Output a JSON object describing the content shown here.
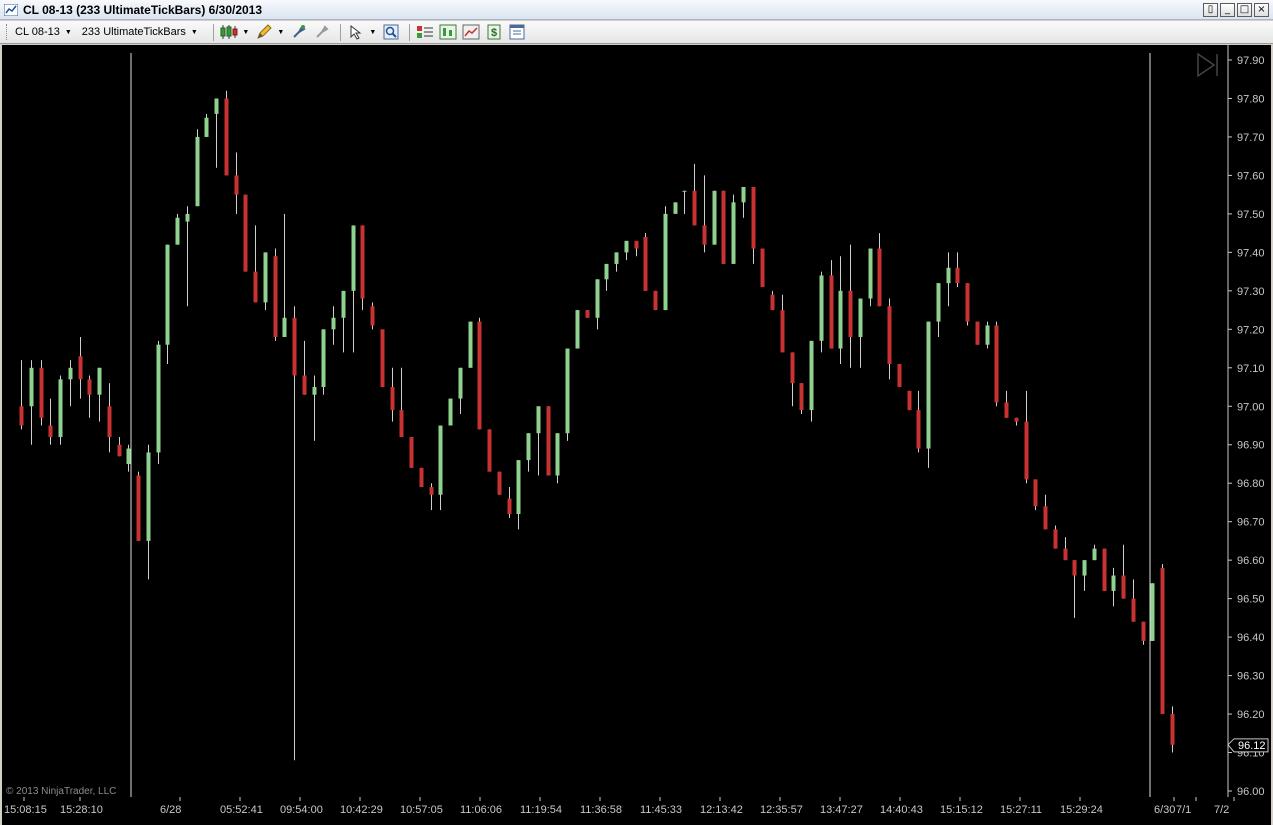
{
  "window": {
    "title": "CL 08-13 (233 UltimateTickBars)  6/30/2013",
    "buttons": [
      "restore-small",
      "minimize",
      "maximize",
      "close"
    ]
  },
  "toolbar": {
    "instrument": "CL 08-13",
    "period": "233 UltimateTickBars",
    "icons": [
      "candlestick-style-icon",
      "pencil-draw-icon",
      "hand-tool-icon",
      "strategy-tool-icon",
      "pointer-icon",
      "zoom-icon",
      "chart-trader-icon",
      "indicators-icon",
      "strategies-icon",
      "dollar-icon",
      "properties-icon"
    ]
  },
  "chart": {
    "copyright": "© 2013 NinjaTrader, LLC",
    "current_price_label": "96.12",
    "colors": {
      "up": "#8fd28f",
      "down": "#c83232",
      "background": "#000000",
      "axis_text": "#c8c8c8",
      "separator": "#e0e0e0"
    },
    "y_ticks": [
      "97.90",
      "97.80",
      "97.70",
      "97.60",
      "97.50",
      "97.40",
      "97.30",
      "97.20",
      "97.10",
      "97.00",
      "96.90",
      "96.80",
      "96.70",
      "96.60",
      "96.50",
      "96.40",
      "96.30",
      "96.20",
      "96.10",
      "96.00"
    ],
    "x_labels": [
      "15:08:15",
      "15:28:10",
      "6/28",
      "05:52:41",
      "09:54:00",
      "10:42:29",
      "10:57:05",
      "11:06:06",
      "11:19:54",
      "11:36:58",
      "11:45:33",
      "12:13:42",
      "12:35:57",
      "13:47:27",
      "14:40:43",
      "15:15:12",
      "15:27:11",
      "15:29:24",
      "6/30",
      "7/1",
      "7/2"
    ]
  },
  "chart_data": {
    "type": "candlestick",
    "title": "CL 08-13 (233 UltimateTickBars)  6/30/2013",
    "ylim": [
      96.0,
      97.9
    ],
    "last_price": 96.12,
    "ohlc": [
      [
        97.0,
        97.12,
        96.94,
        96.95
      ],
      [
        97.0,
        97.12,
        96.9,
        97.1
      ],
      [
        97.1,
        97.12,
        96.95,
        96.97
      ],
      [
        96.95,
        97.02,
        96.9,
        96.92
      ],
      [
        96.92,
        97.08,
        96.9,
        97.07
      ],
      [
        97.07,
        97.12,
        97.0,
        97.1
      ],
      [
        97.13,
        97.18,
        97.02,
        97.07
      ],
      [
        97.07,
        97.08,
        96.97,
        97.03
      ],
      [
        97.03,
        97.08,
        96.96,
        97.1
      ],
      [
        97.0,
        97.06,
        96.88,
        96.92
      ],
      [
        96.9,
        96.92,
        96.87,
        96.87
      ],
      [
        96.85,
        96.9,
        96.83,
        96.89
      ],
      [
        96.82,
        96.83,
        96.65,
        96.65
      ],
      [
        96.65,
        96.9,
        96.55,
        96.88
      ],
      [
        96.88,
        97.17,
        96.85,
        97.16
      ],
      [
        97.16,
        97.42,
        97.11,
        97.42
      ],
      [
        97.42,
        97.5,
        97.42,
        97.49
      ],
      [
        97.48,
        97.52,
        97.26,
        97.5
      ],
      [
        97.52,
        97.72,
        97.52,
        97.7
      ],
      [
        97.7,
        97.76,
        97.7,
        97.75
      ],
      [
        97.76,
        97.8,
        97.62,
        97.8
      ],
      [
        97.8,
        97.82,
        97.6,
        97.6
      ],
      [
        97.6,
        97.66,
        97.5,
        97.55
      ],
      [
        97.55,
        97.55,
        97.35,
        97.35
      ],
      [
        97.35,
        97.47,
        97.3,
        97.27
      ],
      [
        97.27,
        97.4,
        97.25,
        97.4
      ],
      [
        97.39,
        97.41,
        97.17,
        97.18
      ],
      [
        97.18,
        97.5,
        97.18,
        97.23
      ],
      [
        97.23,
        97.26,
        96.08,
        97.08
      ],
      [
        97.08,
        97.17,
        97.04,
        97.03
      ],
      [
        97.03,
        97.08,
        96.91,
        97.05
      ],
      [
        97.05,
        97.2,
        97.03,
        97.2
      ],
      [
        97.2,
        97.26,
        97.16,
        97.23
      ],
      [
        97.23,
        97.3,
        97.14,
        97.3
      ],
      [
        97.3,
        97.47,
        97.14,
        97.47
      ],
      [
        97.47,
        97.47,
        97.25,
        97.28
      ],
      [
        97.26,
        97.27,
        97.2,
        97.21
      ],
      [
        97.2,
        97.16,
        97.05,
        97.05
      ],
      [
        97.05,
        97.1,
        96.96,
        96.99
      ],
      [
        96.99,
        97.1,
        96.92,
        96.92
      ],
      [
        96.92,
        96.9,
        96.88,
        96.84
      ],
      [
        96.84,
        96.83,
        96.8,
        96.79
      ],
      [
        96.79,
        96.8,
        96.73,
        96.77
      ],
      [
        96.77,
        96.84,
        96.73,
        96.95
      ],
      [
        96.95,
        96.95,
        96.95,
        97.02
      ],
      [
        97.02,
        97.1,
        96.98,
        97.1
      ],
      [
        97.1,
        97.22,
        97.1,
        97.22
      ],
      [
        97.22,
        97.23,
        96.95,
        96.94
      ],
      [
        96.94,
        96.94,
        96.84,
        96.83
      ],
      [
        96.83,
        96.82,
        96.77,
        96.77
      ],
      [
        96.76,
        96.79,
        96.71,
        96.72
      ],
      [
        96.72,
        96.8,
        96.68,
        96.86
      ],
      [
        96.86,
        96.86,
        96.83,
        96.93
      ],
      [
        96.93,
        97.0,
        96.82,
        97.0
      ],
      [
        97.0,
        96.98,
        96.82,
        96.82
      ],
      [
        96.82,
        96.93,
        96.8,
        96.93
      ],
      [
        96.93,
        97.15,
        96.91,
        97.15
      ],
      [
        97.15,
        97.25,
        97.15,
        97.25
      ],
      [
        97.25,
        97.23,
        97.24,
        97.23
      ],
      [
        97.23,
        97.33,
        97.2,
        97.33
      ],
      [
        97.33,
        97.37,
        97.3,
        97.37
      ],
      [
        97.37,
        97.4,
        97.35,
        97.4
      ],
      [
        97.4,
        97.43,
        97.38,
        97.43
      ],
      [
        97.43,
        97.43,
        97.39,
        97.41
      ],
      [
        97.44,
        97.45,
        97.3,
        97.3
      ],
      [
        97.3,
        97.3,
        97.25,
        97.25
      ],
      [
        97.25,
        97.52,
        97.25,
        97.5
      ],
      [
        97.5,
        97.53,
        97.5,
        97.53
      ],
      [
        97.56,
        97.56,
        97.5,
        97.56
      ],
      [
        97.56,
        97.63,
        97.47,
        97.47
      ],
      [
        97.47,
        97.6,
        97.4,
        97.42
      ],
      [
        97.42,
        97.56,
        97.42,
        97.56
      ],
      [
        97.56,
        97.56,
        97.42,
        97.37
      ],
      [
        97.37,
        97.55,
        97.37,
        97.53
      ],
      [
        97.53,
        97.5,
        97.49,
        97.57
      ],
      [
        97.57,
        97.55,
        97.37,
        97.41
      ],
      [
        97.41,
        97.29,
        97.38,
        97.31
      ],
      [
        97.29,
        97.3,
        97.25,
        97.25
      ],
      [
        97.25,
        97.29,
        97.14,
        97.14
      ],
      [
        97.14,
        97.13,
        97.0,
        97.06
      ],
      [
        97.06,
        97.05,
        96.98,
        96.99
      ],
      [
        96.99,
        97.17,
        96.96,
        97.17
      ],
      [
        97.17,
        97.35,
        97.14,
        97.34
      ],
      [
        97.34,
        97.38,
        97.15,
        97.15
      ],
      [
        97.15,
        97.39,
        97.11,
        97.3
      ],
      [
        97.3,
        97.42,
        97.1,
        97.18
      ],
      [
        97.18,
        97.28,
        97.1,
        97.28
      ],
      [
        97.28,
        97.41,
        97.26,
        97.41
      ],
      [
        97.41,
        97.45,
        97.26,
        97.26
      ],
      [
        97.26,
        97.28,
        97.07,
        97.11
      ],
      [
        97.11,
        97.11,
        97.05,
        97.05
      ],
      [
        97.04,
        97.04,
        97.01,
        96.99
      ],
      [
        96.99,
        97.04,
        96.88,
        96.89
      ],
      [
        96.89,
        97.22,
        96.84,
        97.22
      ],
      [
        97.22,
        97.32,
        97.18,
        97.32
      ],
      [
        97.32,
        97.4,
        97.26,
        97.36
      ],
      [
        97.36,
        97.4,
        97.31,
        97.32
      ],
      [
        97.32,
        97.32,
        97.21,
        97.22
      ],
      [
        97.22,
        97.22,
        97.16,
        97.16
      ],
      [
        97.16,
        97.22,
        97.15,
        97.21
      ],
      [
        97.21,
        97.22,
        97.0,
        97.01
      ],
      [
        97.01,
        97.04,
        96.98,
        96.97
      ],
      [
        96.97,
        96.95,
        96.95,
        96.96
      ],
      [
        96.96,
        97.04,
        96.8,
        96.81
      ],
      [
        96.81,
        96.8,
        96.73,
        96.74
      ],
      [
        96.74,
        96.77,
        96.68,
        96.68
      ],
      [
        96.68,
        96.69,
        96.64,
        96.63
      ],
      [
        96.63,
        96.66,
        96.6,
        96.6
      ],
      [
        96.6,
        96.6,
        96.45,
        96.56
      ],
      [
        96.56,
        96.6,
        96.52,
        96.6
      ],
      [
        96.6,
        96.64,
        96.61,
        96.63
      ],
      [
        96.63,
        96.62,
        96.52,
        96.52
      ],
      [
        96.52,
        96.58,
        96.48,
        96.56
      ],
      [
        96.56,
        96.64,
        96.5,
        96.5
      ],
      [
        96.5,
        96.55,
        96.44,
        96.44
      ],
      [
        96.44,
        96.42,
        96.38,
        96.39
      ],
      [
        96.39,
        96.54,
        96.39,
        96.54
      ],
      [
        96.58,
        96.59,
        96.2,
        96.2
      ],
      [
        96.2,
        96.22,
        96.1,
        96.12
      ]
    ]
  }
}
